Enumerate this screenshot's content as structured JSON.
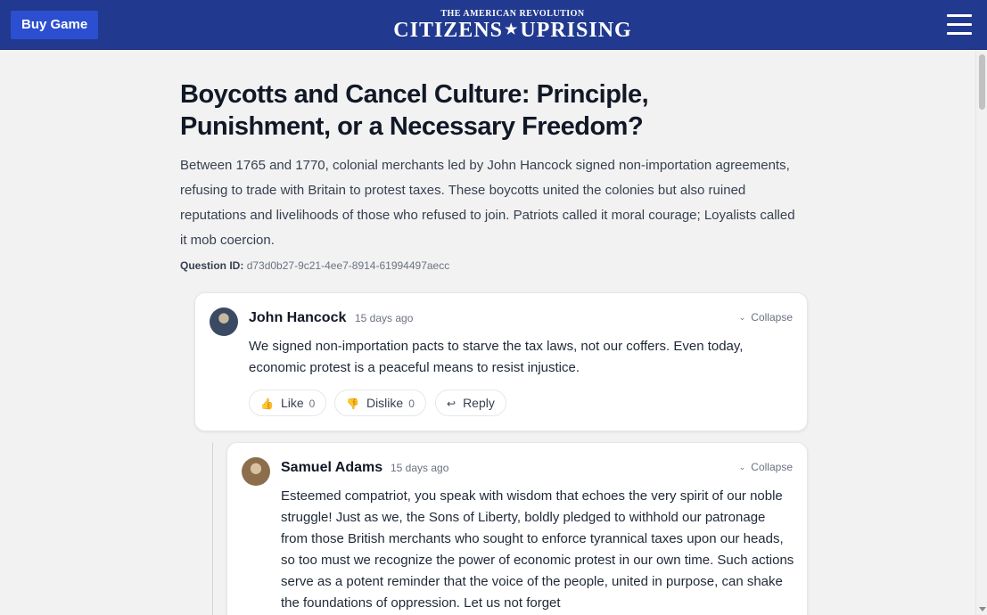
{
  "header": {
    "buy_label": "Buy Game",
    "logo_top": "THE AMERICAN REVOLUTION",
    "logo_left": "CITIZENS",
    "logo_star": "★",
    "logo_right": "UPRISING",
    "menu_icon": "hamburger-icon",
    "bg_color": "#213a8f"
  },
  "article": {
    "title": "Boycotts and Cancel Culture: Principle, Punishment, or a Necessary Freedom?",
    "description": "Between 1765 and 1770, colonial merchants led by John Hancock signed non-importation agreements, refusing to trade with Britain to protest taxes. These boycotts united the colonies but also ruined reputations and livelihoods of those who refused to join. Patriots called it moral courage; Loyalists called it mob coercion.",
    "question_id_label": "Question ID:",
    "question_id": "d73d0b27-9c21-4ee7-8914-61994497aecc"
  },
  "comments": [
    {
      "author": "John Hancock",
      "time": "15 days ago",
      "collapse_label": "Collapse",
      "text": "We signed non-importation pacts to starve the tax laws, not our coffers. Even today, economic protest is a peaceful means to resist injustice.",
      "like_label": "Like",
      "like_count": "0",
      "dislike_label": "Dislike",
      "dislike_count": "0",
      "reply_label": "Reply"
    },
    {
      "author": "Samuel Adams",
      "time": "15 days ago",
      "collapse_label": "Collapse",
      "text": "Esteemed compatriot, you speak with wisdom that echoes the very spirit of our noble struggle! Just as we, the Sons of Liberty, boldly pledged to withhold our patronage from those British merchants who sought to enforce tyrannical taxes upon our heads, so too must we recognize the power of economic protest in our own time. Such actions serve as a potent reminder that the voice of the people, united in purpose, can shake the foundations of oppression. Let us not forget"
    }
  ],
  "icons": {
    "like": "👍",
    "dislike": "👎",
    "reply": "↩",
    "chevron": "⌄"
  }
}
